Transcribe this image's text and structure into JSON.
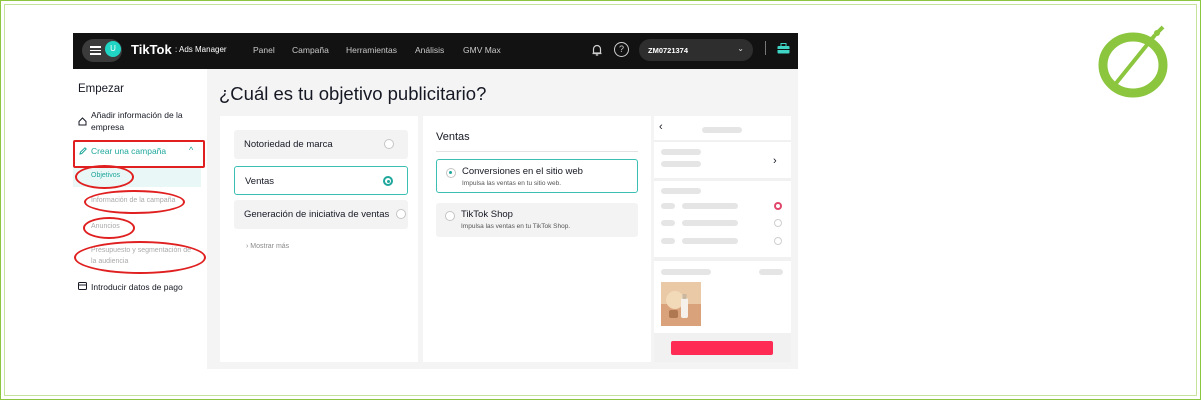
{
  "topbar": {
    "avatar": "U",
    "brand": "TikTok",
    "brand_sub": ": Ads Manager",
    "nav": [
      "Panel",
      "Campaña",
      "Herramientas",
      "Análisis",
      "GMV Max"
    ],
    "account_id": "ZM0721374"
  },
  "sidebar": {
    "title": "Empezar",
    "items": [
      {
        "label_line1": "Añadir información de la",
        "label_line2": "empresa"
      },
      {
        "label": "Crear una campaña"
      },
      {
        "label": "Objetivos"
      },
      {
        "label": "Información de la campaña"
      },
      {
        "label": "Anuncios"
      },
      {
        "label_line1": "Presupuesto y segmentación de",
        "label_line2": "la audiencia"
      },
      {
        "label": "Introducir datos de pago"
      }
    ]
  },
  "main": {
    "title": "¿Cuál es tu objetivo publicitario?",
    "objectives": [
      {
        "label": "Notoriedad de marca",
        "selected": false
      },
      {
        "label": "Ventas",
        "selected": true
      },
      {
        "label": "Generación de iniciativa de ventas",
        "selected": false
      }
    ],
    "show_more": "Mostrar más",
    "panel": {
      "title": "Ventas",
      "options": [
        {
          "title": "Conversiones en el sitio web",
          "desc": "Impulsa las ventas en tu sitio web.",
          "selected": true
        },
        {
          "title": "TikTok Shop",
          "desc": "Impulsa las ventas en tu TikTok Shop.",
          "selected": false
        }
      ]
    }
  },
  "colors": {
    "accent": "#1fa79c",
    "annotation": "#e02020",
    "cta": "#fe2c55",
    "logo": "#8cc63f"
  }
}
